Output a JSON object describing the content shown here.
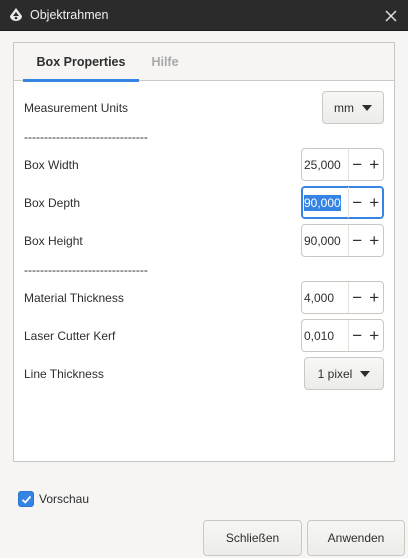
{
  "window": {
    "title": "Objektrahmen",
    "icons": {
      "app": "inkscape-icon",
      "close": "close-icon"
    }
  },
  "tabs": [
    {
      "label": "Box Properties",
      "active": true
    },
    {
      "label": "Hilfe",
      "active": false
    }
  ],
  "form": {
    "units": {
      "label": "Measurement Units",
      "value": "mm"
    },
    "separator1": "-------------------------------",
    "box_width": {
      "label": "Box Width",
      "value": "25,000"
    },
    "box_depth": {
      "label": "Box Depth",
      "value": "90,000"
    },
    "box_height": {
      "label": "Box Height",
      "value": "90,000"
    },
    "separator2": "-------------------------------",
    "material_thickness": {
      "label": "Material Thickness",
      "value": "4,000"
    },
    "kerf": {
      "label": "Laser Cutter Kerf",
      "value": "0,010"
    },
    "line_thickness": {
      "label": "Line Thickness",
      "value": "1 pixel"
    }
  },
  "spin_symbols": {
    "minus": "−",
    "plus": "+"
  },
  "preview": {
    "label": "Vorschau",
    "checked": true
  },
  "buttons": {
    "close": "Schließen",
    "apply": "Anwenden"
  },
  "colors": {
    "accent": "#3584e4",
    "titlebar": "#2b2b2b"
  }
}
